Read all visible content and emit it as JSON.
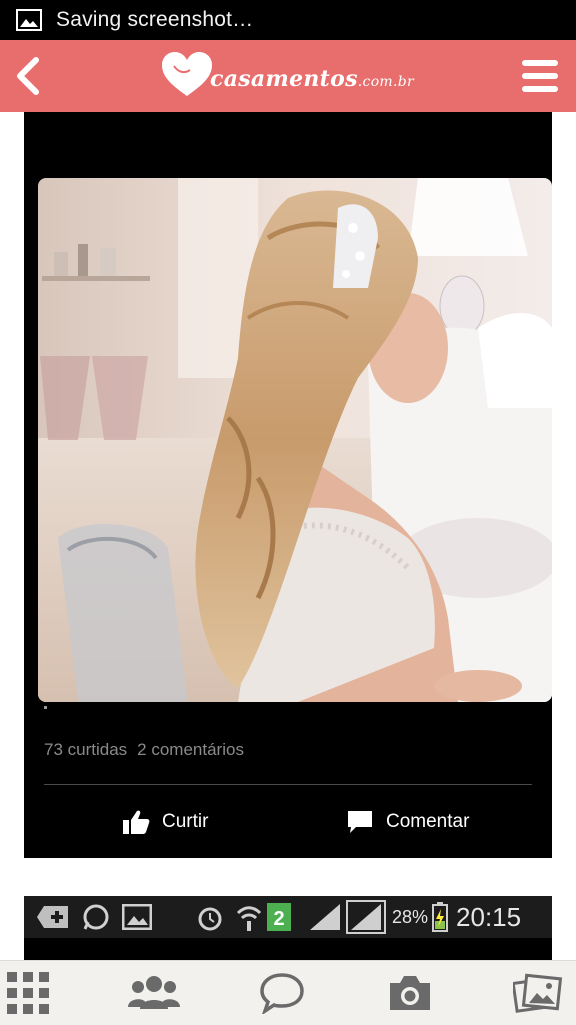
{
  "status_bar": {
    "notification_icon": "image-icon",
    "notification_text": "Saving screenshot…"
  },
  "app_bar": {
    "back_icon": "chevron-left-icon",
    "logo_text": "casamentos",
    "logo_suffix": ".com.br",
    "menu_icon": "hamburger-menu-icon",
    "brand_color": "#e86d6d"
  },
  "post": {
    "image_alt": "bride with half-up wavy hairstyle and tiara",
    "stats": {
      "likes": "73 curtidas",
      "comments": "2 comentários"
    },
    "actions": {
      "like_label": "Curtir",
      "like_icon": "thumbs-up-icon",
      "comment_label": "Comentar",
      "comment_icon": "speech-bubble-icon"
    }
  },
  "next_post": {
    "embedded_status": {
      "battery": "28%",
      "time": "20:15",
      "sim_badge": "2"
    }
  },
  "bottom_nav": {
    "items": [
      {
        "icon": "grid-icon"
      },
      {
        "icon": "community-icon"
      },
      {
        "icon": "chat-bubble-icon"
      },
      {
        "icon": "camera-icon"
      },
      {
        "icon": "photos-icon"
      }
    ]
  }
}
